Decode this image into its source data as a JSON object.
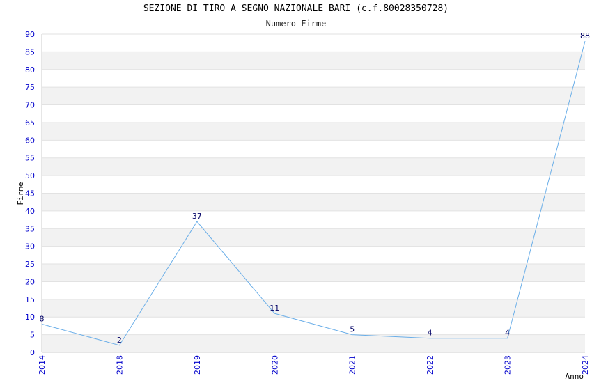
{
  "chart_data": {
    "type": "line",
    "title": "SEZIONE DI TIRO A SEGNO NAZIONALE BARI (c.f.80028350728)",
    "subtitle": "Numero Firme",
    "xlabel": "Anno",
    "ylabel": "Firme",
    "categories": [
      "2014",
      "2018",
      "2019",
      "2020",
      "2021",
      "2022",
      "2023",
      "2024"
    ],
    "series": [
      {
        "values": [
          8,
          2,
          37,
          11,
          5,
          4,
          4,
          88
        ]
      }
    ],
    "ylim": [
      0,
      90
    ],
    "ytick_step": 5,
    "grid": true,
    "line_color": "#6aaee8",
    "band_color": "#f2f2f2",
    "tick_color": "#0000cc",
    "label_color": "#000066"
  }
}
